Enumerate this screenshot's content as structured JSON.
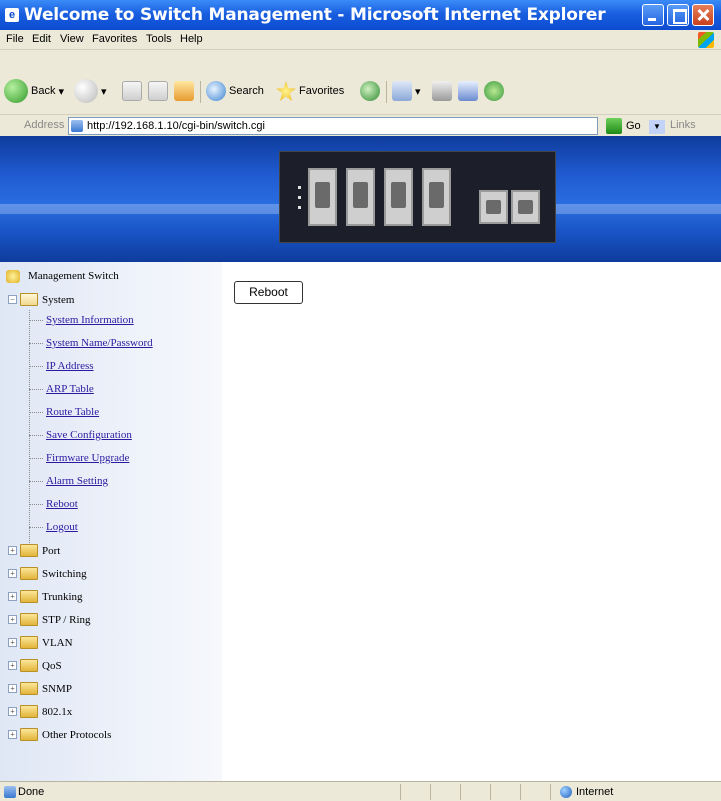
{
  "window": {
    "title": "Welcome to Switch Management - Microsoft Internet Explorer"
  },
  "menu": [
    "File",
    "Edit",
    "View",
    "Favorites",
    "Tools",
    "Help"
  ],
  "toolbar": {
    "back_label": "Back",
    "search_label": "Search",
    "favorites_label": "Favorites"
  },
  "address": {
    "label": "Address",
    "url": "http://192.168.1.10/cgi-bin/switch.cgi",
    "go_label": "Go",
    "links_label": "Links"
  },
  "tree": {
    "root": "Management Switch",
    "system": {
      "label": "System",
      "items": [
        "System Information",
        "System Name/Password",
        "IP Address",
        "ARP Table",
        "Route Table",
        "Save Configuration",
        "Firmware Upgrade",
        "Alarm Setting",
        "Reboot",
        "Logout"
      ]
    },
    "folders": [
      "Port",
      "Switching",
      "Trunking",
      "STP / Ring",
      "VLAN",
      "QoS",
      "SNMP",
      "802.1x",
      "Other Protocols"
    ]
  },
  "content": {
    "reboot_button": "Reboot"
  },
  "status": {
    "text": "Done",
    "zone": "Internet"
  },
  "colors": {
    "titlebar": "#0c4bd1",
    "banner": "#1f5ad0",
    "link": "#2a1aa0"
  }
}
